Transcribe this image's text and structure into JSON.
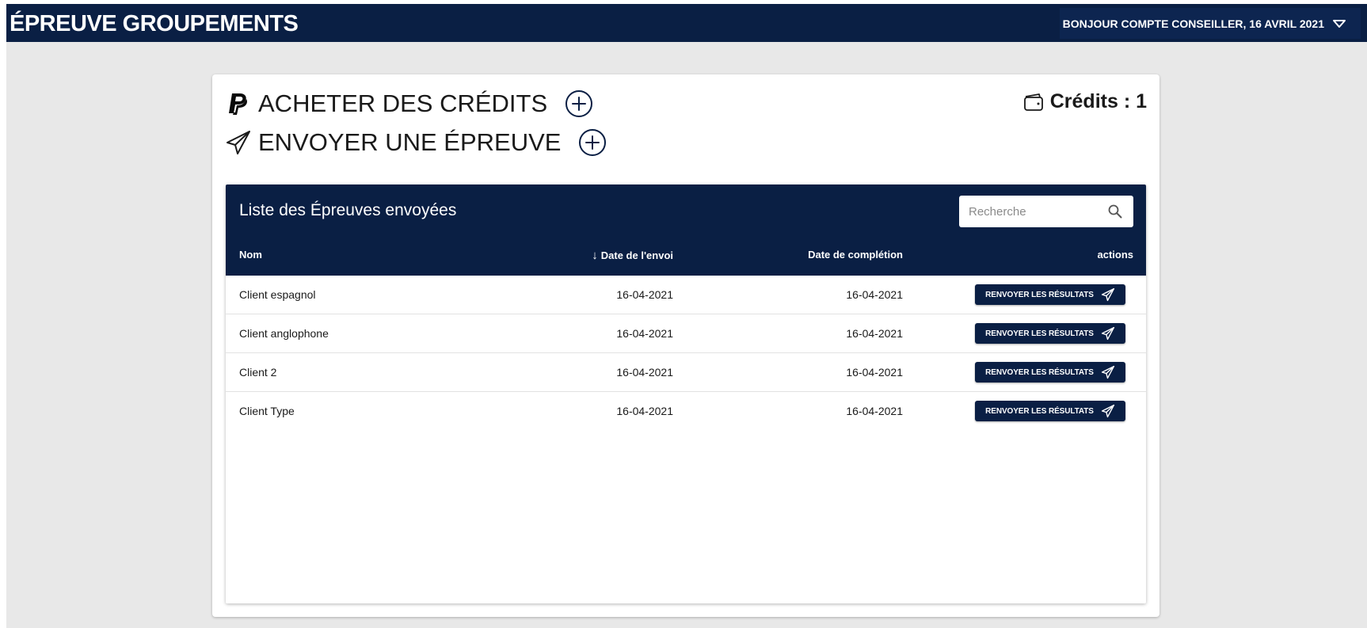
{
  "header": {
    "title": "ÉPREUVE GROUPEMENTS",
    "user_menu_label": "BONJOUR COMPTE CONSEILLER, 16 AVRIL 2021"
  },
  "actions": {
    "buy_credits_label": "ACHETER DES CRÉDITS",
    "send_test_label": "ENVOYER UNE ÉPREUVE"
  },
  "credits": {
    "label": "Crédits : 1"
  },
  "table": {
    "title": "Liste des Épreuves envoyées",
    "search_placeholder": "Recherche",
    "columns": {
      "name": "Nom",
      "sent_date": "Date de l'envoi",
      "completion_date": "Date de complétion",
      "actions": "actions"
    },
    "sort_indicator": "↓",
    "rows": [
      {
        "name": "Client espagnol",
        "sent_date": "16-04-2021",
        "completion_date": "16-04-2021",
        "action_label": "RENVOYER LES RÉSULTATS"
      },
      {
        "name": "Client anglophone",
        "sent_date": "16-04-2021",
        "completion_date": "16-04-2021",
        "action_label": "RENVOYER LES RÉSULTATS"
      },
      {
        "name": "Client 2",
        "sent_date": "16-04-2021",
        "completion_date": "16-04-2021",
        "action_label": "RENVOYER LES RÉSULTATS"
      },
      {
        "name": "Client Type",
        "sent_date": "16-04-2021",
        "completion_date": "16-04-2021",
        "action_label": "RENVOYER LES RÉSULTATS"
      }
    ]
  },
  "icons": {
    "header_dropdown": "triangle-down-icon",
    "buy_credits": "paypal-icon",
    "send_test": "paper-plane-icon",
    "add": "plus-circle-icon",
    "credits": "wallet-icon",
    "search": "search-icon",
    "resend": "paper-plane-icon"
  },
  "colors": {
    "primary_navy": "#0a1f44",
    "page_background": "#e8e8e8"
  }
}
